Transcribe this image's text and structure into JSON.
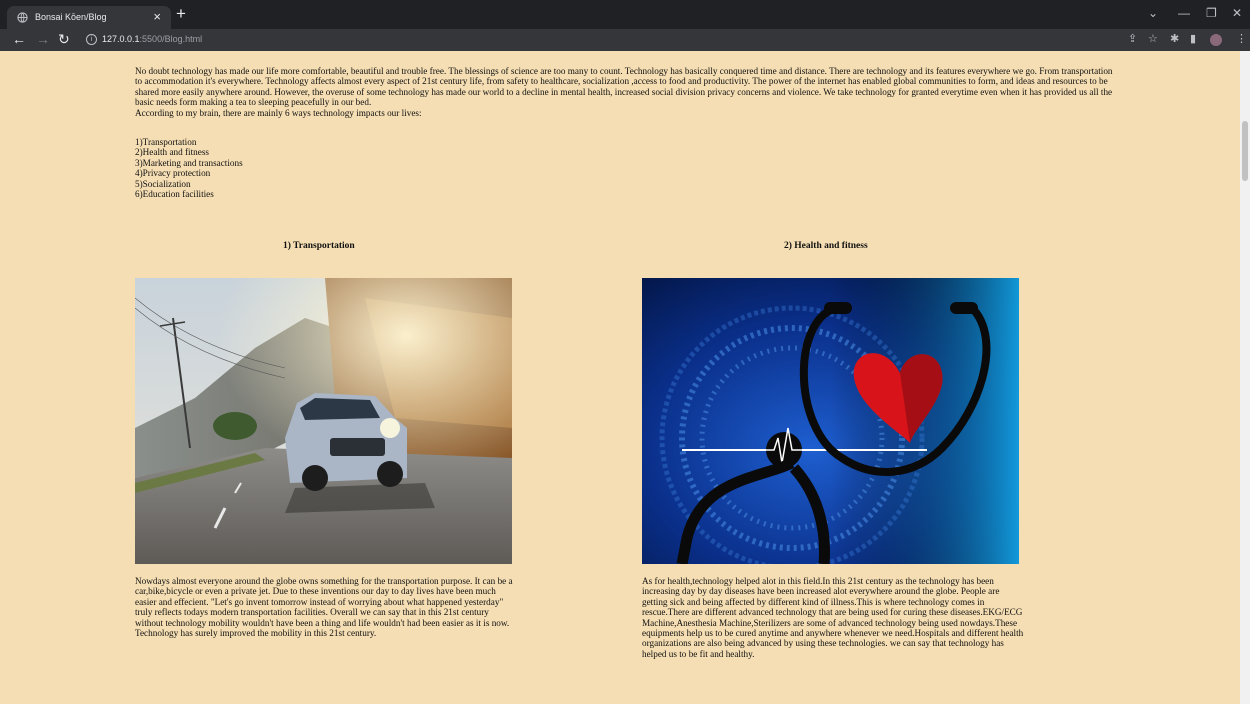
{
  "browser": {
    "tab_title": "Bonsai Kōen/Blog",
    "url_host": "127.0.0.1",
    "url_rest": ":5500/Blog.html"
  },
  "blog": {
    "intro": "No doubt technology has made our life more comfortable, beautiful and trouble free. The blessings of science are too many to count. Technology has basically conquered time and distance. There are technology and its features everywhere we go. From transportation to accommodation it's everywhere. Technology affects almost every aspect of 21st century life, from safety to healthcare, socialization ,access to food and productivity. The power of the internet has enabled global communities to form, and ideas and resources to be shared more easily anywhere around. However, the overuse of some technology has made our world to a decline in mental health, increased social division privacy concerns and violence. We take technology for granted everytime even when it has provided us all the basic needs form making a tea to sleeping peacefully in our bed.",
    "intro_line2": "According to my brain, there are mainly 6 ways technology impacts our lives:",
    "ways": [
      "1)Transportation",
      "2)Health and fitness",
      "3)Marketing and transactions",
      "4)Privacy protection",
      "5)Socialization",
      "6)Education facilities"
    ],
    "sections": [
      {
        "heading": "1) Transportation",
        "text": "Nowdays almost everyone around the globe owns something for the transportation purpose. It can be a car,bike,bicycle or even a private jet. Due to these inventions our day to day lives have been much easier and effecient. \"Let's go invent tomorrow instead of worrying about what happened yesterday\" truly reflects todays modern transportation facilities. Overall we can say that in this 21st century without technology mobility wouldn't have been a thing and life wouldn't had been easier as it is now. Technology has surely improved the mobility in this 21st century."
      },
      {
        "heading": "2) Health and fitness",
        "text": "As for health,technology helped alot in this field.In this 21st century as the technology has been increasing day by day diseases have been increased alot everywhere around the globe. People are getting sick and being affected by different kind of illness.This is where technology comes in rescue.There are different advanced technology that are being used for curing these diseases.EKG/ECG Machine,Anesthesia Machine,Sterilizers are some of advanced technology being used nowdays.These equipments help us to be cured anytime and anywhere whenever we need.Hospitals and different health organizations are also being advanced by using these technologies. we can say that technology has helped us to be fit and healthy."
      }
    ]
  }
}
